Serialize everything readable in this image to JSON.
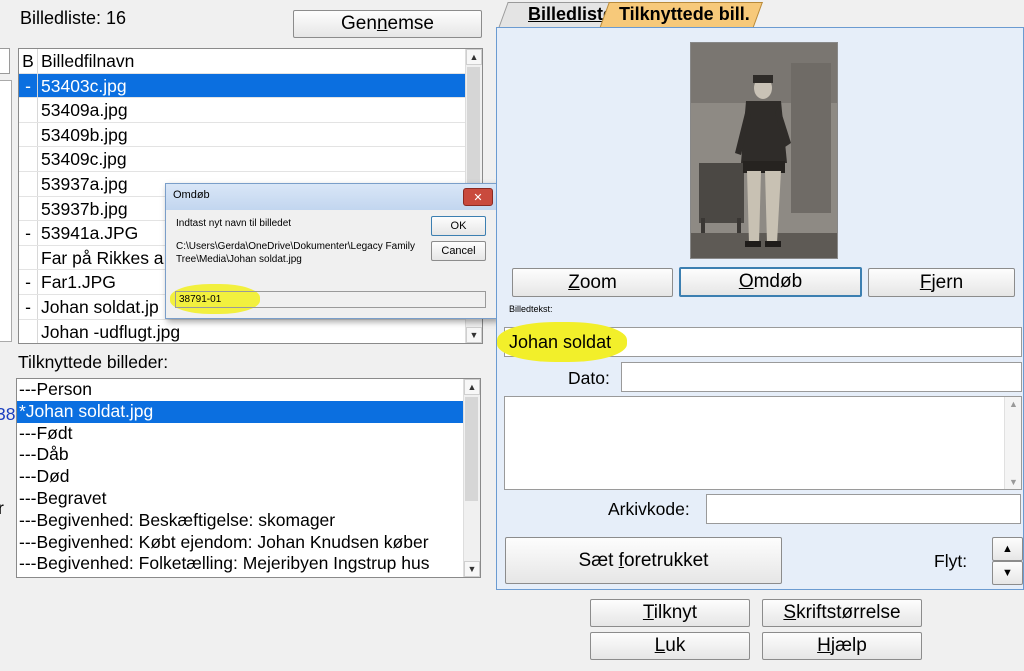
{
  "left": {
    "list_count_label": "Billedliste: 16",
    "gennemse_button": {
      "pre": "Gen",
      "u": "n",
      "post": "emse"
    },
    "file_table": {
      "col1_header": "B",
      "col2_header": "Billedfilnavn",
      "rows": [
        {
          "mark": "-",
          "name": "53403c.jpg",
          "selected": true
        },
        {
          "mark": "",
          "name": "53409a.jpg"
        },
        {
          "mark": "",
          "name": "53409b.jpg"
        },
        {
          "mark": "",
          "name": "53409c.jpg"
        },
        {
          "mark": "",
          "name": "53937a.jpg"
        },
        {
          "mark": "",
          "name": "53937b.jpg"
        },
        {
          "mark": "-",
          "name": "53941a.JPG"
        },
        {
          "mark": "",
          "name": "Far på Rikkes a"
        },
        {
          "mark": "-",
          "name": "Far1.JPG"
        },
        {
          "mark": "-",
          "name": "Johan soldat.jp"
        },
        {
          "mark": "",
          "name": "Johan -udflugt.jpg"
        }
      ]
    },
    "linked_label": "Tilknyttede billeder:",
    "linked_list": [
      {
        "text": "---Person"
      },
      {
        "text": "*Johan soldat.jpg",
        "selected": true
      },
      {
        "text": "---Født"
      },
      {
        "text": "---Dåb"
      },
      {
        "text": "---Død"
      },
      {
        "text": "---Begravet"
      },
      {
        "text": "---Begivenhed: Beskæftigelse: skomager"
      },
      {
        "text": "---Begivenhed: Købt ejendom: Johan Knudsen køber"
      },
      {
        "text": "---Begivenhed: Folketælling: Mejeribyen Ingstrup hus"
      }
    ],
    "edge_text_38": "38",
    "edge_text_r": "r"
  },
  "dialog": {
    "title": "Omdøb",
    "prompt": "Indtast nyt navn til billedet",
    "path": "C:\\Users\\Gerda\\OneDrive\\Dokumenter\\Legacy Family Tree\\Media\\Johan soldat.jpg",
    "ok_label": "OK",
    "cancel_label": "Cancel",
    "input_value": "38791-01"
  },
  "right": {
    "tabs": [
      {
        "label": "Billedliste",
        "active": false
      },
      {
        "label": "Tilknyttede bill.",
        "active": true
      }
    ],
    "buttons": {
      "zoom": {
        "u": "Z",
        "post": "oom"
      },
      "omdob": {
        "u": "O",
        "post": "mdøb"
      },
      "fjern": {
        "u": "F",
        "post": "jern"
      }
    },
    "caption_label": "Billedtekst:",
    "caption_value": "Johan soldat",
    "date_label": "Dato:",
    "date_value": "",
    "archive_label": "Arkivkode:",
    "archive_value": "",
    "preferred_button": {
      "pre": "Sæt ",
      "u": "f",
      "post": "oretrukket"
    },
    "move_label": "Flyt:"
  },
  "bottom": {
    "tilknyt": {
      "u": "T",
      "post": "ilknyt"
    },
    "skrift": {
      "u": "S",
      "post": "kriftstørrelse"
    },
    "luk": {
      "u": "L",
      "post": "uk"
    },
    "hjaelp": {
      "u": "H",
      "post": "jælp"
    }
  },
  "colors": {
    "selection": "#0b6fe0",
    "highlight": "#f2ef2a",
    "tab_active": "#f7c97a",
    "panel_border": "#6b9bd1"
  }
}
